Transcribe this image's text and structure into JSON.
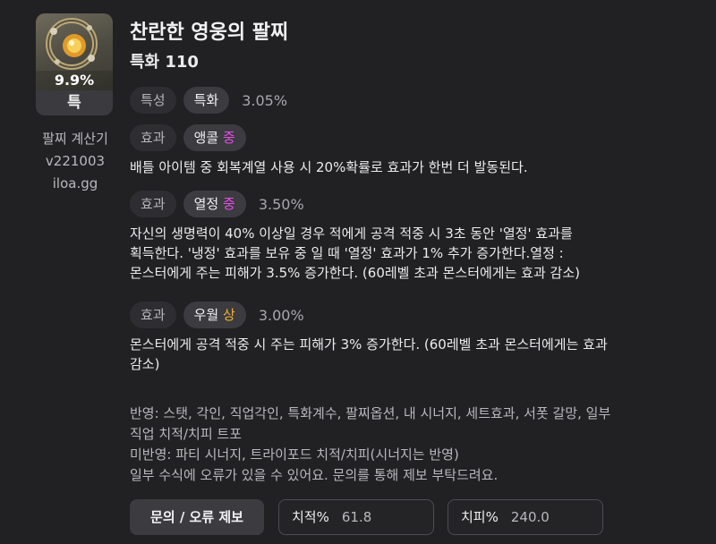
{
  "item": {
    "percent": "9.9%",
    "tier": "특",
    "icon": "bracelet-icon"
  },
  "credits": [
    "팔찌 계산기",
    "v221003",
    "iloa.gg"
  ],
  "title": "찬란한 영웅의 팔찌",
  "subtitle": "특화 110",
  "stat_row": {
    "tag": "특성",
    "name": "특화",
    "value": "3.05%"
  },
  "effects": [
    {
      "tag": "효과",
      "name": "앵콜",
      "grade": "중",
      "value": "",
      "desc": [
        "배틀 아이템 중 회복계열 사용 시 20%확률로 효과가 한번 더 발동된다."
      ]
    },
    {
      "tag": "효과",
      "name": "열정",
      "grade": "중",
      "value": "3.50%",
      "desc": [
        "자신의 생명력이 40% 이상일 경우 적에게 공격 적중 시 3초 동안 '열정' 효과를",
        "획득한다. '냉정' 효과를 보유 중 일 때 '열정' 효과가 1% 추가 증가한다.열정 :",
        "몬스터에게 주는 피해가 3.5% 증가한다. (60레벨 초과 몬스터에게는 효과 감소)"
      ]
    },
    {
      "tag": "효과",
      "name": "우월",
      "grade": "상",
      "value": "3.00%",
      "desc": [
        "몬스터에게 공격 적중 시 주는 피해가 3% 증가한다. (60레벨 초과 몬스터에게는 효과",
        "감소)"
      ]
    }
  ],
  "notes": [
    "반영: 스탯, 각인, 직업각인, 특화계수, 팔찌옵션, 내 시너지, 세트효과, 서폿 갈망, 일부",
    "직업 치적/치피 트포",
    "미반영: 파티 시너지, 트라이포드 치적/치피(시너지는 반영)",
    "일부 수식에 오류가 있을 수 있어요. 문의를 통해 제보 부탁드려요."
  ],
  "footer": {
    "report_label": "문의 / 오류 제보",
    "crit_rate_label": "치적%",
    "crit_rate_value": "61.8",
    "crit_dmg_label": "치피%",
    "crit_dmg_value": "240.0"
  },
  "colors": {
    "background": "#212124",
    "grade_mid": "#e54ee5",
    "grade_high": "#f2b233"
  }
}
